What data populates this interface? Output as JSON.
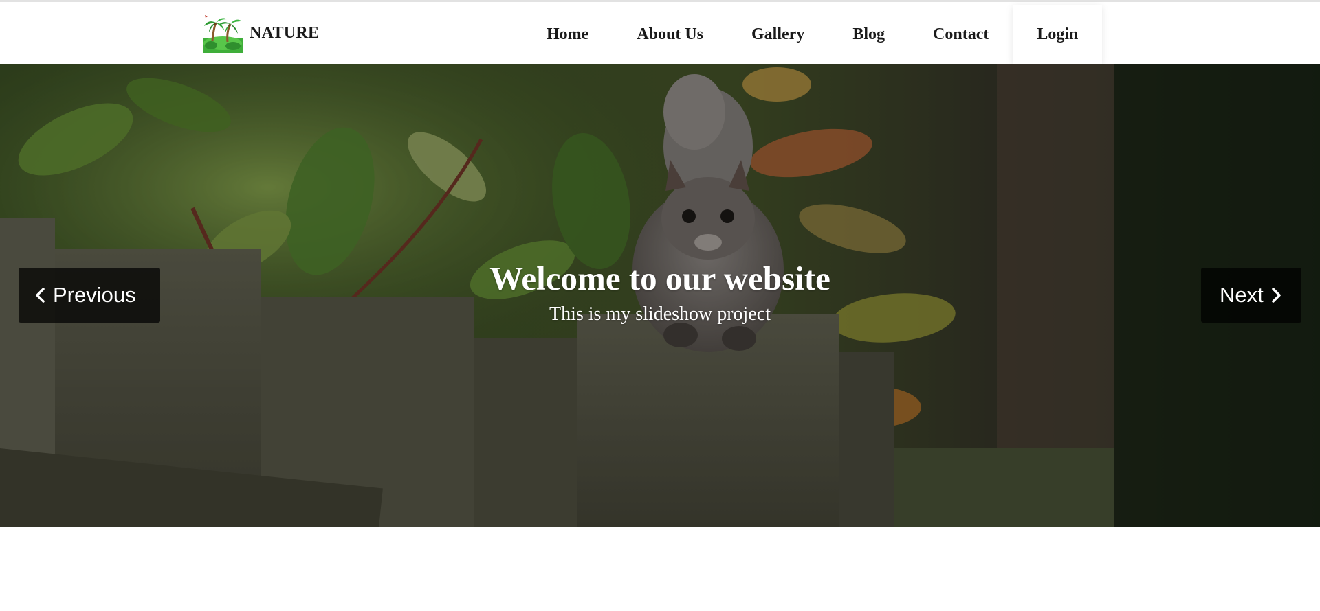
{
  "brand": {
    "name": "NATURE",
    "logo_icon": "palm-trees-logo-icon"
  },
  "nav": {
    "items": [
      {
        "label": "Home"
      },
      {
        "label": "About Us"
      },
      {
        "label": "Gallery"
      },
      {
        "label": "Blog"
      },
      {
        "label": "Contact"
      },
      {
        "label": "Login"
      }
    ]
  },
  "slideshow": {
    "title": "Welcome to our website",
    "subtitle": "This is my slideshow project",
    "prev_label": "Previous",
    "next_label": "Next",
    "prev_icon": "chevron-left-icon",
    "next_icon": "chevron-right-icon",
    "image_subject": "squirrel-on-fence"
  },
  "colors": {
    "nav_text": "#1a1a1a",
    "overlay_button": "#000000",
    "caption_text": "#ffffff"
  }
}
